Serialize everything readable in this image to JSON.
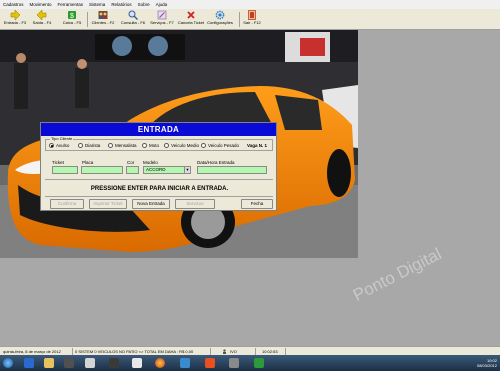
{
  "menu": [
    "Cadastros",
    "Movimento",
    "Ferramentas",
    "Sistema",
    "Relatórios",
    "Sobre",
    "Ajuda"
  ],
  "toolbar": [
    {
      "label": "Entrada - F3",
      "icon": "arrow-right-icon",
      "color": "#e4c400"
    },
    {
      "label": "Saída - F4",
      "icon": "arrow-left-icon",
      "color": "#e4c400"
    },
    {
      "label": "Caixa - F5",
      "icon": "money-icon",
      "color": "#2a9a2a"
    },
    {
      "label": "Clientes - F2",
      "icon": "users-icon",
      "color": "#7a4a2a"
    },
    {
      "label": "Consulta - F6",
      "icon": "search-icon",
      "color": "#3a5a9a"
    },
    {
      "label": "Serviços - F7",
      "icon": "tools-icon",
      "color": "#8a5a9a"
    },
    {
      "label": "Cancela Ticket",
      "icon": "cancel-icon",
      "color": "#d02020"
    },
    {
      "label": "Configurações",
      "icon": "gear-icon",
      "color": "#2a7ad0"
    },
    {
      "label": "Sair - F12",
      "icon": "exit-icon",
      "color": "#c04020"
    }
  ],
  "dialog": {
    "title": "ENTRADA",
    "tipo_cliente_label": "Tipo Cliente",
    "tipo_cliente_options": [
      "Avulso",
      "Diarista",
      "Mensalista",
      "Moto",
      "Veiculo Medio",
      "Veiculo Pesado"
    ],
    "tipo_cliente_selected": "Avulso",
    "vaga": "Vaga N. 1",
    "fields": {
      "ticket_label": "Ticket",
      "placa_label": "Placa",
      "cor_label": "Cor",
      "modelo_label": "Modelo",
      "modelo_value": "ACCORD",
      "data_hora_label": "Data/Hora Entrada"
    },
    "message": "PRESSIONE ENTER PARA INICIAR A ENTRADA.",
    "buttons": [
      {
        "label": "Confirma",
        "enabled": false
      },
      {
        "label": "Imprimir Ticket",
        "enabled": false
      },
      {
        "label": "Nova Entrada",
        "enabled": true
      },
      {
        "label": "Servicos",
        "enabled": false
      },
      {
        "label": "Fecha",
        "enabled": true
      }
    ]
  },
  "watermark": "Ponto Digital",
  "statusbar": {
    "date": "quinta-feira, 8 de março de 2012",
    "info": "0 SISTEM  0 VEICULOS NO PATIO <> TOTAL EM DAHA : R$ 0,00",
    "mode": "IVO",
    "time": "10:02:53"
  },
  "taskbar": {
    "clock_time": "10:02",
    "clock_date": "08/03/2012"
  }
}
